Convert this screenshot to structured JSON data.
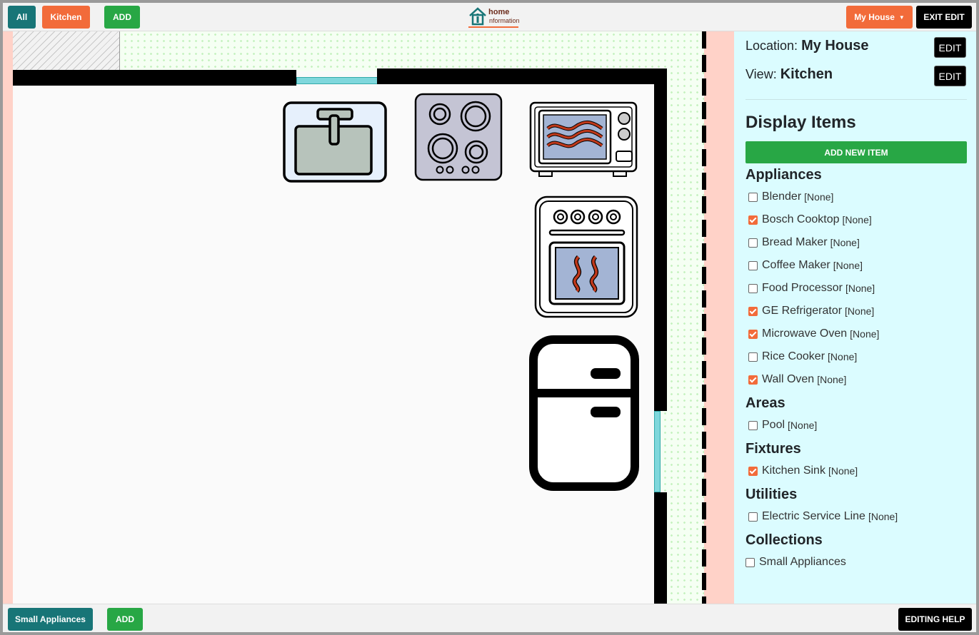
{
  "topbar": {
    "all_label": "All",
    "kitchen_label": "Kitchen",
    "add_label": "ADD",
    "logo_line1": "home",
    "logo_line2": "nformation",
    "location_menu_label": "My House",
    "exit_edit_label": "EXIT EDIT"
  },
  "bottombar": {
    "collection_label": "Small Appliances",
    "add_label": "ADD",
    "help_label": "EDITING HELP"
  },
  "panel": {
    "location_prefix": "Location:",
    "location_value": "My House",
    "view_prefix": "View:",
    "view_value": "Kitchen",
    "edit_label": "EDIT",
    "display_items_title": "Display Items",
    "add_new_item_label": "ADD NEW ITEM",
    "none_tag": "[None]",
    "categories": {
      "appliances": {
        "title": "Appliances",
        "items": [
          {
            "label": "Blender",
            "checked": false
          },
          {
            "label": "Bosch Cooktop",
            "checked": true
          },
          {
            "label": "Bread Maker",
            "checked": false
          },
          {
            "label": "Coffee Maker",
            "checked": false
          },
          {
            "label": "Food Processor",
            "checked": false
          },
          {
            "label": "GE Refrigerator",
            "checked": true
          },
          {
            "label": "Microwave Oven",
            "checked": true
          },
          {
            "label": "Rice Cooker",
            "checked": false
          },
          {
            "label": "Wall Oven",
            "checked": true
          }
        ]
      },
      "areas": {
        "title": "Areas",
        "items": [
          {
            "label": "Pool",
            "checked": false
          }
        ]
      },
      "fixtures": {
        "title": "Fixtures",
        "items": [
          {
            "label": "Kitchen Sink",
            "checked": true
          }
        ]
      },
      "utilities": {
        "title": "Utilities",
        "items": [
          {
            "label": "Electric Service Line",
            "checked": false
          }
        ]
      },
      "collections": {
        "title": "Collections",
        "items": [
          {
            "label": "Small Appliances",
            "checked": false
          }
        ]
      }
    }
  },
  "colors": {
    "teal": "#187577",
    "orange": "#f26b3a",
    "green": "#28a745",
    "panel_bg": "#dbfcff"
  }
}
